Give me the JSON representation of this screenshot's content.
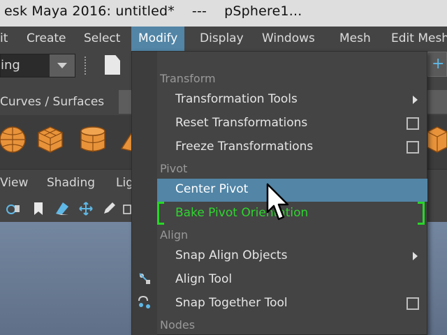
{
  "window": {
    "title": "esk Maya 2016: untitled*    ---    pSphere1..."
  },
  "menubar": {
    "items": [
      "it",
      "Create",
      "Select",
      "Modify",
      "Display",
      "Windows",
      "Mesh",
      "Edit Mesh"
    ],
    "active": "Modify"
  },
  "statusline": {
    "mode_value": "ing"
  },
  "shelf": {
    "tab_label": "Curves / Surfaces",
    "icons": [
      "sphere-icon",
      "cube-icon",
      "cylinder-icon",
      "cone-icon",
      "cube-icon"
    ]
  },
  "panel_menu": {
    "items": [
      "View",
      "Shading",
      "Lig"
    ]
  },
  "modify_menu": {
    "sections": {
      "transform": "Transform",
      "pivot": "Pivot",
      "align": "Align",
      "nodes": "Nodes"
    },
    "items": [
      {
        "label": "Transformation Tools",
        "submenu": true
      },
      {
        "label": "Reset Transformations",
        "option_box": true
      },
      {
        "label": "Freeze Transformations",
        "option_box": true
      },
      {
        "label": "Center Pivot",
        "highlighted": true
      },
      {
        "label": "Bake Pivot Orientation",
        "marked": true
      },
      {
        "label": "Snap Align Objects",
        "submenu": true
      },
      {
        "label": "Align Tool"
      },
      {
        "label": "Snap Together Tool",
        "option_box": true
      }
    ]
  },
  "colors": {
    "highlight": "#5285a6",
    "marked_text": "#2ed52e",
    "menu_bg": "#444444"
  }
}
